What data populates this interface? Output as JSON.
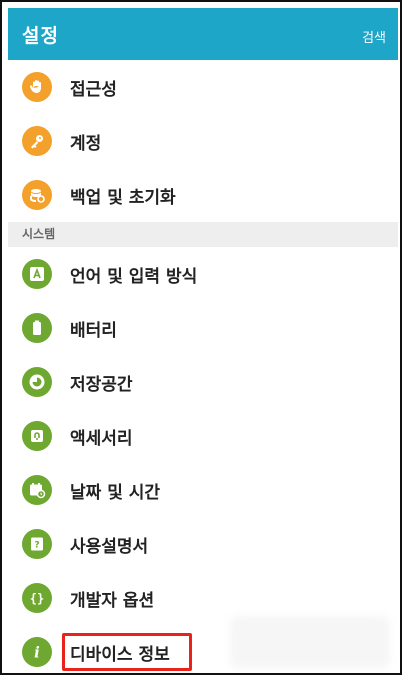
{
  "header": {
    "title": "설정",
    "search_label": "검색"
  },
  "groups": [
    {
      "items": [
        {
          "label": "접근성",
          "icon": "accessibility-hand-icon",
          "color": "#f3a12b"
        },
        {
          "label": "계정",
          "icon": "key-icon",
          "color": "#f3a12b"
        },
        {
          "label": "백업 및 초기화",
          "icon": "backup-reset-icon",
          "color": "#f3a12b"
        }
      ]
    },
    {
      "section": "시스템",
      "items": [
        {
          "label": "언어 및 입력 방식",
          "icon": "language-input-icon",
          "color": "#6ea830"
        },
        {
          "label": "배터리",
          "icon": "battery-icon",
          "color": "#6ea830"
        },
        {
          "label": "저장공간",
          "icon": "storage-icon",
          "color": "#6ea830"
        },
        {
          "label": "액세서리",
          "icon": "accessory-icon",
          "color": "#6ea830"
        },
        {
          "label": "날짜 및 시간",
          "icon": "calendar-clock-icon",
          "color": "#6ea830"
        },
        {
          "label": "사용설명서",
          "icon": "user-manual-icon",
          "color": "#6ea830"
        },
        {
          "label": "개발자 옵션",
          "icon": "developer-braces-icon",
          "color": "#6ea830"
        },
        {
          "label": "디바이스 정보",
          "icon": "info-icon",
          "color": "#6ea830",
          "highlighted": true
        }
      ]
    }
  ]
}
